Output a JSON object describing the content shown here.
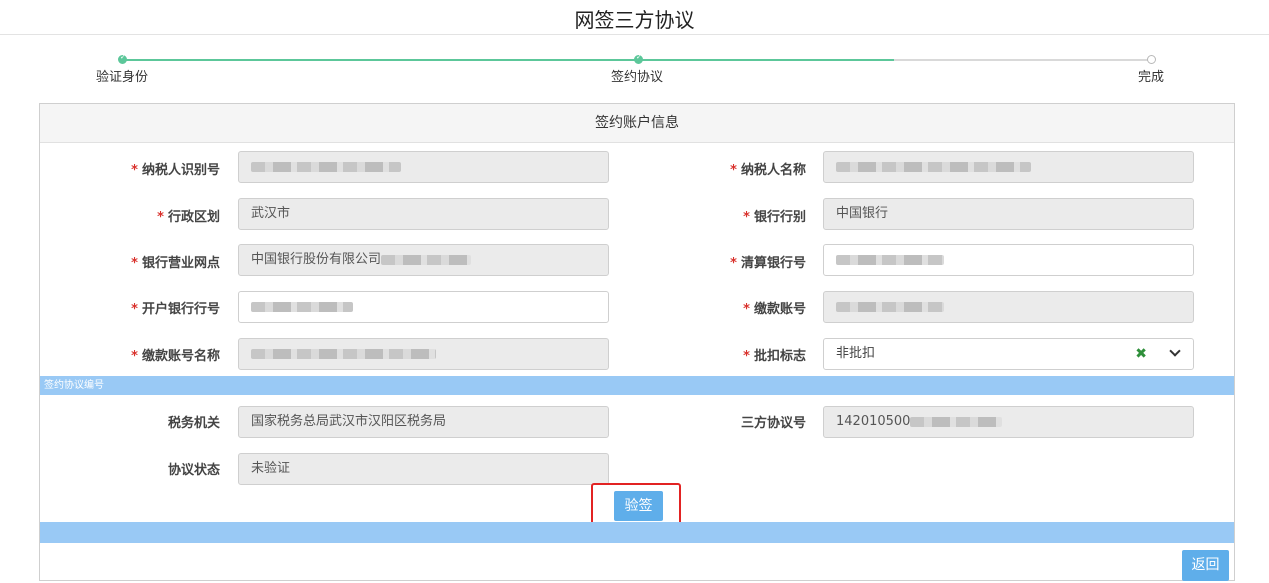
{
  "page": {
    "title": "网签三方协议"
  },
  "stepper": {
    "steps": [
      {
        "label": "验证身份",
        "state": "done"
      },
      {
        "label": "签约协议",
        "state": "done"
      },
      {
        "label": "完成",
        "state": "pending"
      }
    ]
  },
  "panel": {
    "header": "签约账户信息",
    "fields": {
      "taxpayer_id": {
        "label": "纳税人识别号",
        "required": true,
        "value": ""
      },
      "taxpayer_name": {
        "label": "纳税人名称",
        "required": true,
        "value": ""
      },
      "admin_region": {
        "label": "行政区划",
        "required": true,
        "value": "武汉市"
      },
      "bank_category": {
        "label": "银行行别",
        "required": true,
        "value": "中国银行"
      },
      "bank_branch": {
        "label": "银行营业网点",
        "required": true,
        "value": "中国银行股份有限公司"
      },
      "clearing_bank_no": {
        "label": "清算银行号",
        "required": true,
        "value": ""
      },
      "opening_bank_no": {
        "label": "开户银行行号",
        "required": true,
        "value": ""
      },
      "payment_account": {
        "label": "缴款账号",
        "required": true,
        "value": ""
      },
      "payment_account_name": {
        "label": "缴款账号名称",
        "required": true,
        "value": ""
      },
      "batch_flag": {
        "label": "批扣标志",
        "required": true,
        "value": "非批扣"
      }
    },
    "section_protocol": "签约协议编号",
    "protocol": {
      "tax_authority": {
        "label": "税务机关",
        "value": "国家税务总局武汉市汉阳区税务局"
      },
      "protocol_no": {
        "label": "三方协议号",
        "value": "142010500"
      },
      "protocol_status": {
        "label": "协议状态",
        "value": "未验证"
      }
    },
    "sign_button": "验签",
    "back_button": "返回"
  },
  "icons": {
    "clear": "clear-x-icon",
    "dropdown": "chevron-down-icon",
    "step_done": "check-icon"
  },
  "colors": {
    "accent": "#5faeea",
    "section_bar": "#99c9f5",
    "step_done": "#5cc79a",
    "required": "#d9312c",
    "highlight": "#e22323"
  }
}
